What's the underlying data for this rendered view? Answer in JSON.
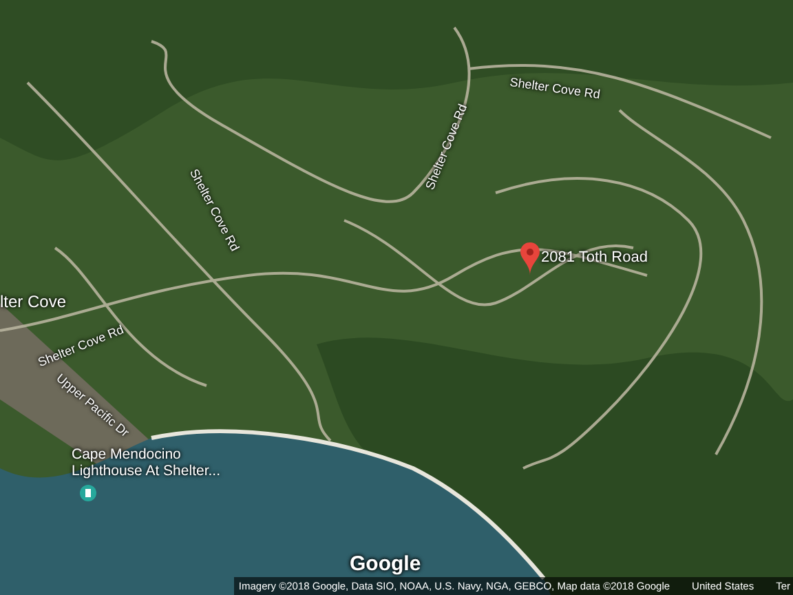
{
  "map": {
    "labels": [
      {
        "kind": "road",
        "text": "Shelter Cove Rd"
      },
      {
        "kind": "road",
        "text": "Shelter Cove Rd"
      },
      {
        "kind": "road",
        "text": "Shelter Cove Rd"
      },
      {
        "kind": "place",
        "text": "lter Cove"
      },
      {
        "kind": "road",
        "text": "Shelter Cove Rd"
      },
      {
        "kind": "road",
        "text": "Upper Pacific Dr"
      },
      {
        "kind": "poi",
        "text": "Cape Mendocino Lighthouse At Shelter..."
      }
    ],
    "pin": {
      "label": "2081 Toth Road"
    },
    "logo": "Google",
    "attribution": {
      "imagery": "Imagery ©2018 Google, Data SIO, NOAA, U.S. Navy, NGA, GEBCO, Map data ©2018 Google",
      "region": "United States",
      "terms": "Ter"
    }
  }
}
